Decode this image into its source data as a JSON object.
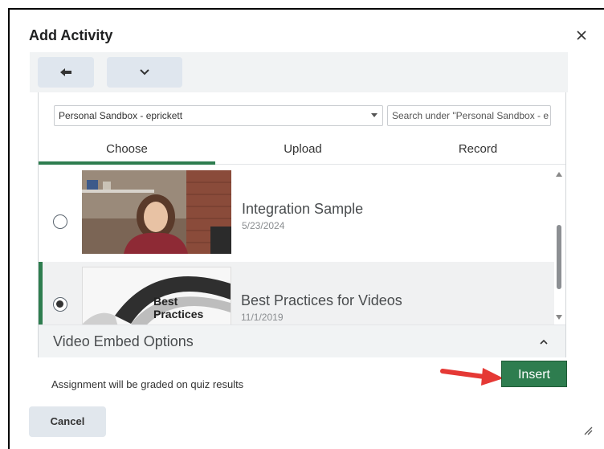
{
  "dialog": {
    "title": "Add Activity",
    "close_icon": "close-icon"
  },
  "toolbar": {
    "back_icon": "arrow-left-icon",
    "more_icon": "chevron-down-icon"
  },
  "source": {
    "selected": "Personal Sandbox - eprickett",
    "search_placeholder": "Search under \"Personal Sandbox - e"
  },
  "tabs": [
    {
      "label": "Choose",
      "active": true
    },
    {
      "label": "Upload",
      "active": false
    },
    {
      "label": "Record",
      "active": false
    }
  ],
  "videos": [
    {
      "title": "Integration Sample",
      "date": "5/23/2024",
      "selected": false
    },
    {
      "title": "Best Practices for Videos",
      "date": "11/1/2019",
      "selected": true,
      "thumb_text_1": "Best",
      "thumb_text_2": "Practices"
    }
  ],
  "embed_options": {
    "label": "Video Embed Options"
  },
  "footer": {
    "note": "Assignment will be graded on quiz results",
    "insert_label": "Insert",
    "cancel_label": "Cancel"
  },
  "colors": {
    "accent_green": "#2e7d4f",
    "annotation_red": "#e53935",
    "button_bg": "#e1e7ed"
  }
}
